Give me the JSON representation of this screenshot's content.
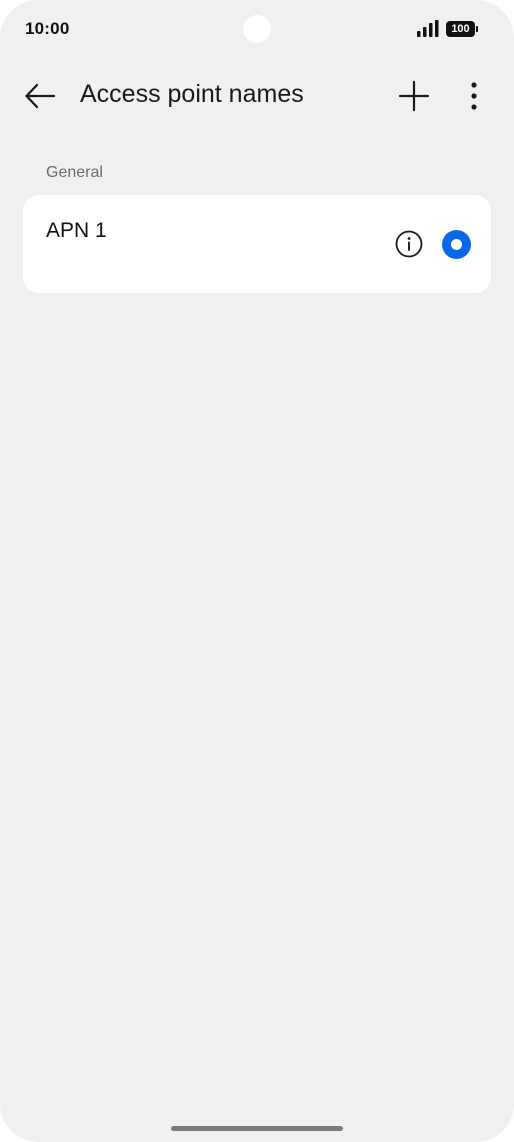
{
  "status_bar": {
    "time": "10:00",
    "battery_level": "100",
    "icons": [
      "signal-icon",
      "battery-icon"
    ]
  },
  "app_bar": {
    "title": "Access point names",
    "icons": [
      "back-arrow-icon",
      "plus-icon",
      "more-vertical-icon"
    ]
  },
  "section": {
    "header": "General",
    "items": [
      {
        "name": "APN 1",
        "selected": true,
        "icons": [
          "info-icon",
          "radio-selected-icon"
        ]
      }
    ]
  },
  "colors": {
    "background": "#eff0f2",
    "card": "#ffffff",
    "accent": "#0a67e8",
    "text_primary": "#111111",
    "text_secondary": "#6b6b6b"
  }
}
